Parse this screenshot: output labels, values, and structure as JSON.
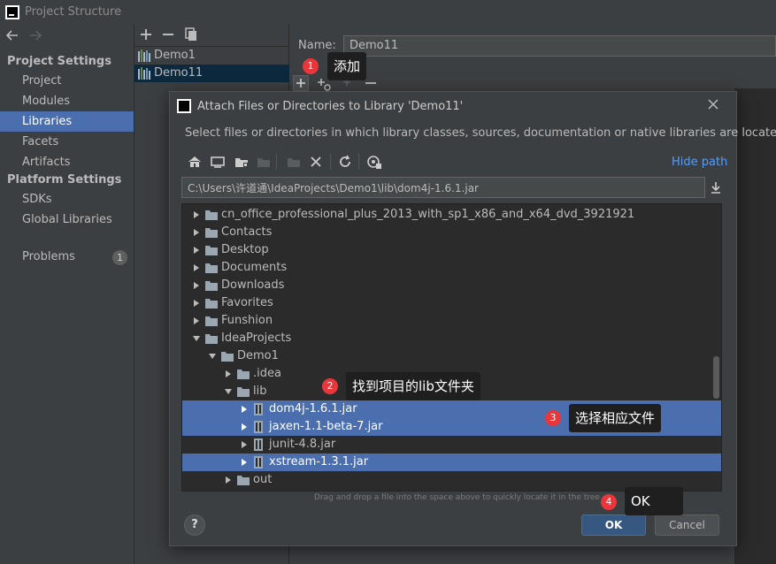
{
  "window": {
    "title": "Project Structure"
  },
  "nav": {
    "project_settings_heading": "Project Settings",
    "project_items": [
      "Project",
      "Modules",
      "Libraries",
      "Facets",
      "Artifacts"
    ],
    "platform_settings_heading": "Platform Settings",
    "platform_items": [
      "SDKs",
      "Global Libraries"
    ],
    "problems_label": "Problems",
    "problems_count": "1",
    "selected": "Libraries"
  },
  "libraries": {
    "items": [
      "Demo1",
      "Demo11"
    ],
    "selected": "Demo11"
  },
  "detail": {
    "name_label": "Name:",
    "name_value": "Demo11"
  },
  "dialog": {
    "title": "Attach Files or Directories to Library 'Demo11'",
    "description": "Select files or directories in which library classes, sources, documentation or native libraries are located",
    "hide_path_label": "Hide path",
    "path_value": "C:\\Users\\许道通\\IdeaProjects\\Demo1\\lib\\dom4j-1.6.1.jar",
    "tree": [
      {
        "label": "cn_office_professional_plus_2013_with_sp1_x86_and_x64_dvd_3921921",
        "kind": "folder",
        "expanded": false,
        "selected": false
      },
      {
        "label": "Contacts",
        "kind": "folder",
        "expanded": false,
        "selected": false
      },
      {
        "label": "Desktop",
        "kind": "folder",
        "expanded": false,
        "selected": false
      },
      {
        "label": "Documents",
        "kind": "folder",
        "expanded": false,
        "selected": false
      },
      {
        "label": "Downloads",
        "kind": "folder",
        "expanded": false,
        "selected": false
      },
      {
        "label": "Favorites",
        "kind": "folder",
        "expanded": false,
        "selected": false
      },
      {
        "label": "Funshion",
        "kind": "folder",
        "expanded": false,
        "selected": false
      },
      {
        "label": "IdeaProjects",
        "kind": "folder",
        "expanded": true,
        "selected": false
      },
      {
        "label": "Demo1",
        "kind": "folder",
        "expanded": true,
        "selected": false
      },
      {
        "label": ".idea",
        "kind": "folder",
        "expanded": false,
        "selected": false
      },
      {
        "label": "lib",
        "kind": "folder",
        "expanded": true,
        "selected": false
      },
      {
        "label": "dom4j-1.6.1.jar",
        "kind": "jar",
        "expanded": false,
        "selected": true
      },
      {
        "label": "jaxen-1.1-beta-7.jar",
        "kind": "jar",
        "expanded": false,
        "selected": true
      },
      {
        "label": "junit-4.8.jar",
        "kind": "jar",
        "expanded": false,
        "selected": false
      },
      {
        "label": "xstream-1.3.1.jar",
        "kind": "jar",
        "expanded": false,
        "selected": true
      },
      {
        "label": "out",
        "kind": "folder",
        "expanded": false,
        "selected": false
      }
    ],
    "drag_hint": "Drag and drop a file into the space above to quickly locate it in the tree",
    "ok_label": "OK",
    "cancel_label": "Cancel",
    "help_label": "?"
  },
  "annotations": [
    {
      "number": "1",
      "text": "添加"
    },
    {
      "number": "2",
      "text": "找到项目的lib文件夹"
    },
    {
      "number": "3",
      "text": "选择相应文件"
    },
    {
      "number": "4",
      "text": "OK"
    }
  ],
  "colors": {
    "background": "#3c3f41",
    "tree_background": "#2b2b2b",
    "selection": "#4b6eaf",
    "accent_link": "#589df6",
    "annotation_dot": "#e8363a",
    "ok_button": "#365880"
  }
}
